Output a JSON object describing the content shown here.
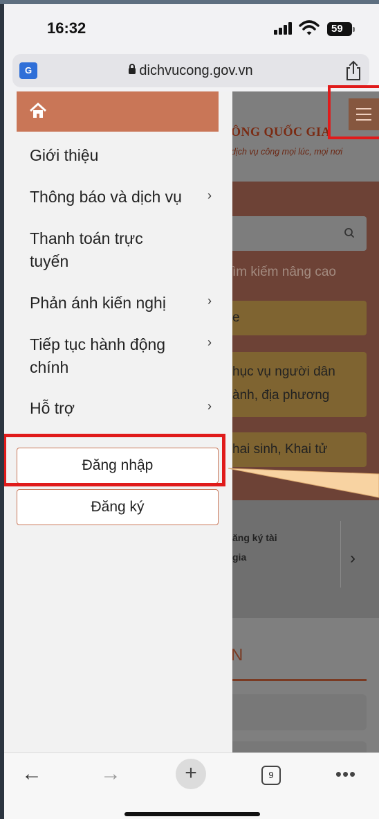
{
  "status_bar": {
    "time": "16:32",
    "battery": "59"
  },
  "browser": {
    "url": "dichvucong.gov.vn",
    "tab_count": "9"
  },
  "background_page": {
    "title": "ÔNG QUỐC GIA",
    "subtitle": "dịch vụ công mọi lúc, mọi nơi",
    "advanced_search": "ìm kiếm nâng cao",
    "card_1": "e",
    "card_2_line1": "hục vụ người dân",
    "card_2_line2": "ành, địa phương",
    "card_3": "hai sinh, Khai tử",
    "register_line1": "ăng ký tài",
    "register_line2": "gia",
    "section_heading": "N"
  },
  "drawer": {
    "items": [
      {
        "label": "Giới thiệu",
        "has_submenu": false
      },
      {
        "label": "Thông báo và dịch vụ",
        "has_submenu": true
      },
      {
        "label": "Thanh toán trực tuyến",
        "has_submenu": false
      },
      {
        "label": "Phản ánh kiến nghị",
        "has_submenu": true
      },
      {
        "label": "Tiếp tục hành động chính",
        "has_submenu": true
      },
      {
        "label": "Hỗ trợ",
        "has_submenu": true
      }
    ],
    "login_label": "Đăng nhập",
    "register_label": "Đăng ký"
  },
  "colors": {
    "accent": "#c97657",
    "highlight": "#e01b1b",
    "callout": "#f8d3a2"
  },
  "icons": [
    "home-icon",
    "menu-icon",
    "translate-icon",
    "lock-icon",
    "share-icon",
    "search-icon",
    "back-icon",
    "forward-icon",
    "new-tab-icon",
    "tabs-icon",
    "more-icon"
  ]
}
